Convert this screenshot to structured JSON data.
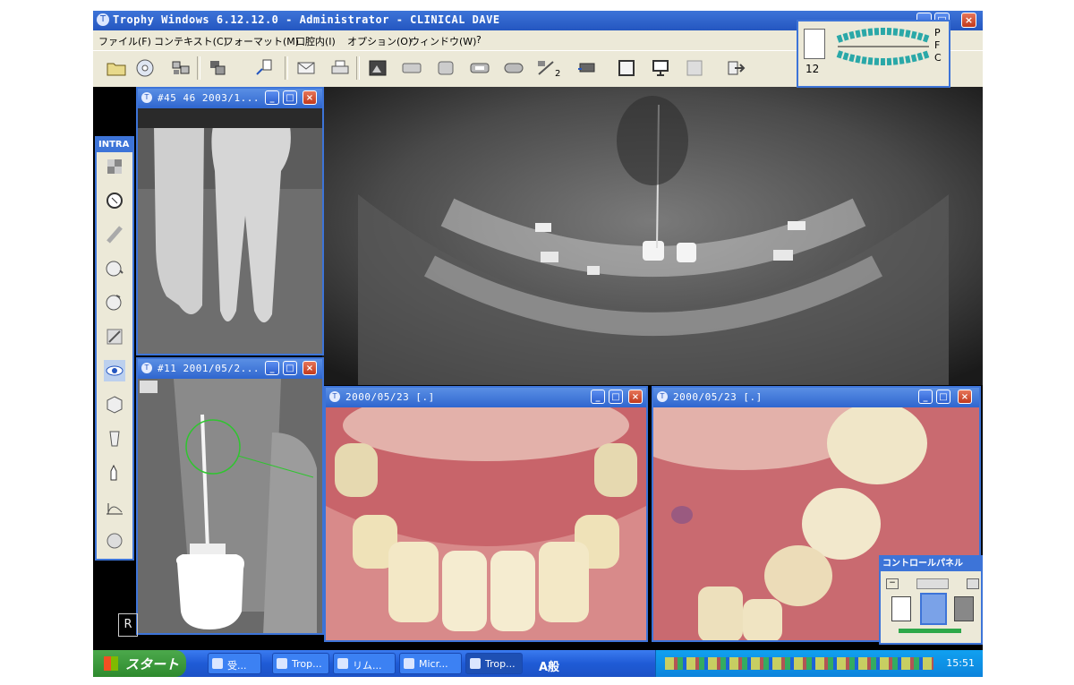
{
  "app": {
    "title": "Trophy Windows 6.12.12.0 - Administrator  - CLINICAL DAVE",
    "window_controls": {
      "minimize": "_",
      "maximize": "□",
      "close": "×"
    }
  },
  "menu": {
    "items": [
      "ファイル(F)",
      "コンテキスト(C)",
      "フォーマット(M)",
      "口腔内(I)",
      "オプション(O)",
      "ウィンドウ(W)",
      "?"
    ]
  },
  "toolbar": {
    "icons": [
      "open-folder-icon",
      "cd-icon",
      "camera-icon",
      "layout-icon",
      "import-icon",
      "mail-icon",
      "print-icon",
      "image-icon",
      "film-icon",
      "capture-icon",
      "scan-icon",
      "sensor-icon",
      "compare-icon",
      "projector-icon",
      "frame-icon",
      "monitor-icon",
      "blank-icon",
      "exit-icon"
    ],
    "counter_label": "2"
  },
  "chart_panel": {
    "tooth_number": "12",
    "letters": [
      "P",
      "F",
      "C"
    ]
  },
  "intra_toolbar": {
    "title": "INTRA",
    "tools": [
      "mosaic-icon",
      "magnify-icon",
      "ruler-icon",
      "rotate-180-icon",
      "rotate-90-icon",
      "draw-icon",
      "eye-icon",
      "cube-icon",
      "tooth-icon",
      "hand-icon",
      "histogram-icon",
      "tooth-chart-icon"
    ]
  },
  "windows": [
    {
      "id": "xray-small-1",
      "title": "#45 46 2003/1..."
    },
    {
      "id": "xray-small-2",
      "title": "#11 2001/05/2..."
    },
    {
      "id": "photo-1",
      "title": "2000/05/23  [.]"
    },
    {
      "id": "photo-2",
      "title": "2000/05/23  [.]"
    }
  ],
  "corner_label": "R",
  "control_panel": {
    "title": "コントロールパネル"
  },
  "taskbar": {
    "start_label": "スタート",
    "items": [
      {
        "label": "受...",
        "active": false
      },
      {
        "label": "Trop...",
        "active": false
      },
      {
        "label": "リム...",
        "active": false
      },
      {
        "label": "Micr...",
        "active": false
      },
      {
        "label": "Trop...",
        "active": true
      }
    ],
    "ime_label": "A般",
    "clock": "15:51"
  },
  "colors": {
    "titlebar": "#2f66cf",
    "chrome": "#ece9d8",
    "taskbar": "#1f5bd6",
    "start": "#2e8a2e"
  }
}
